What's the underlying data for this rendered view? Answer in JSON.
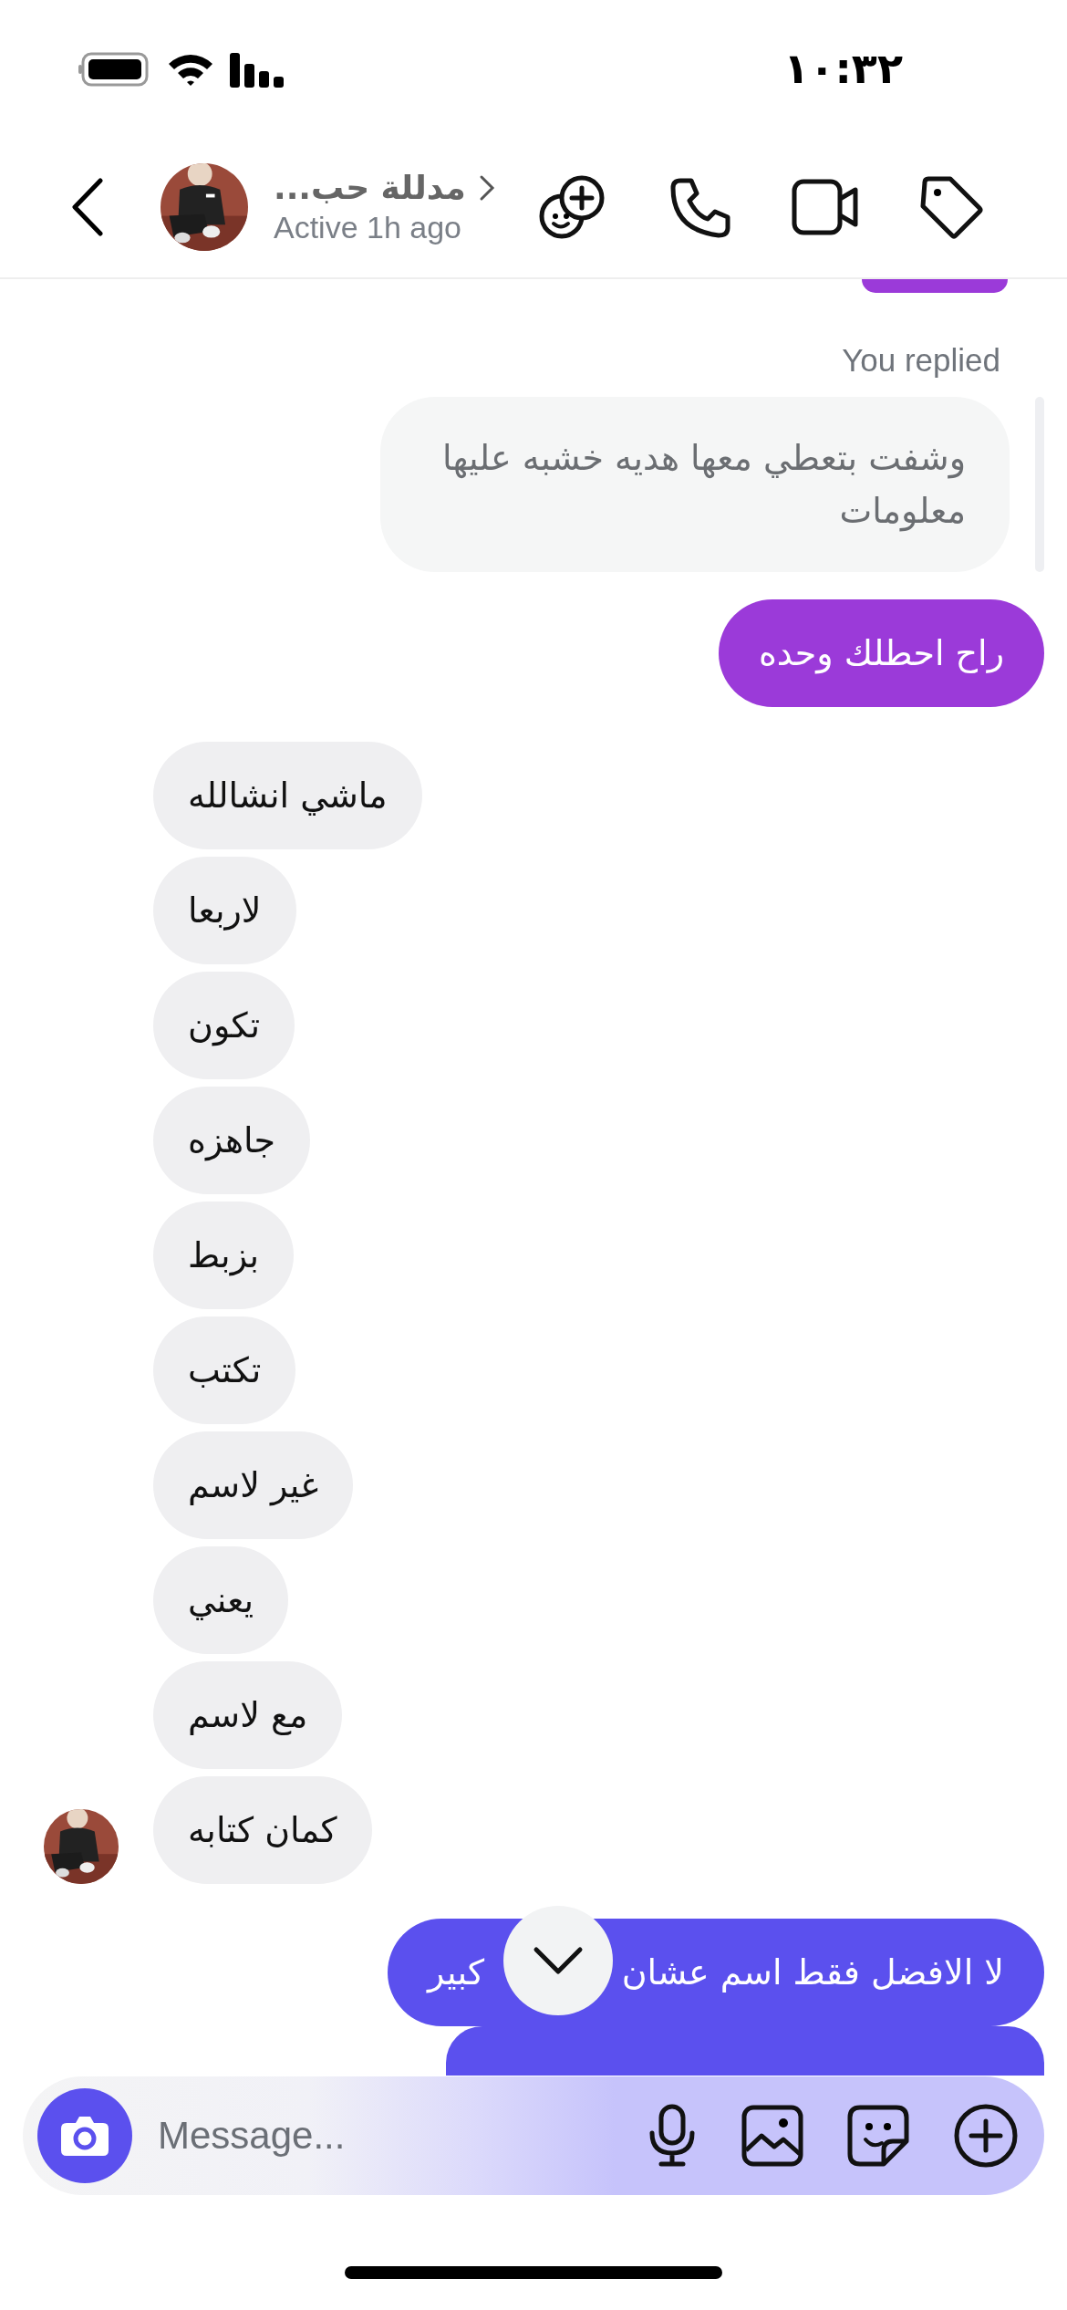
{
  "status_bar": {
    "time": "١٠:٣٢"
  },
  "header": {
    "name": "مدللة حب...",
    "status": "Active 1h ago"
  },
  "messages": [
    {
      "kind": "clipped-outgoing",
      "color": "#9b3ad9"
    },
    {
      "kind": "reply-label",
      "text": "You replied"
    },
    {
      "kind": "reply-quote",
      "text": "وشفت بتعطي معها هديه خشبه عليها معلومات"
    },
    {
      "kind": "outgoing",
      "text": "راح احطلك وحده",
      "color": "#9b3ad9"
    },
    {
      "kind": "incoming",
      "text": "ماشي انشالله",
      "show_avatar": false
    },
    {
      "kind": "incoming",
      "text": "لاربعا",
      "show_avatar": false
    },
    {
      "kind": "incoming",
      "text": "تكون",
      "show_avatar": false
    },
    {
      "kind": "incoming",
      "text": "جاهزه",
      "show_avatar": false
    },
    {
      "kind": "incoming",
      "text": "بزبط",
      "show_avatar": false
    },
    {
      "kind": "incoming",
      "text": "تكتب",
      "show_avatar": false
    },
    {
      "kind": "incoming",
      "text": "غير لاسم",
      "show_avatar": false
    },
    {
      "kind": "incoming",
      "text": "يعني",
      "show_avatar": false
    },
    {
      "kind": "incoming",
      "text": "مع لاسم",
      "show_avatar": false
    },
    {
      "kind": "incoming",
      "text": "كمان كتابه",
      "show_avatar": true
    },
    {
      "kind": "split-outgoing",
      "text_right": "لا الافضل فقط اسم عشان",
      "text_left": "كبير",
      "color": "#5b50ee"
    },
    {
      "kind": "clipped-outgoing",
      "color": "#5b50ee"
    }
  ],
  "composer": {
    "placeholder": "Message..."
  }
}
